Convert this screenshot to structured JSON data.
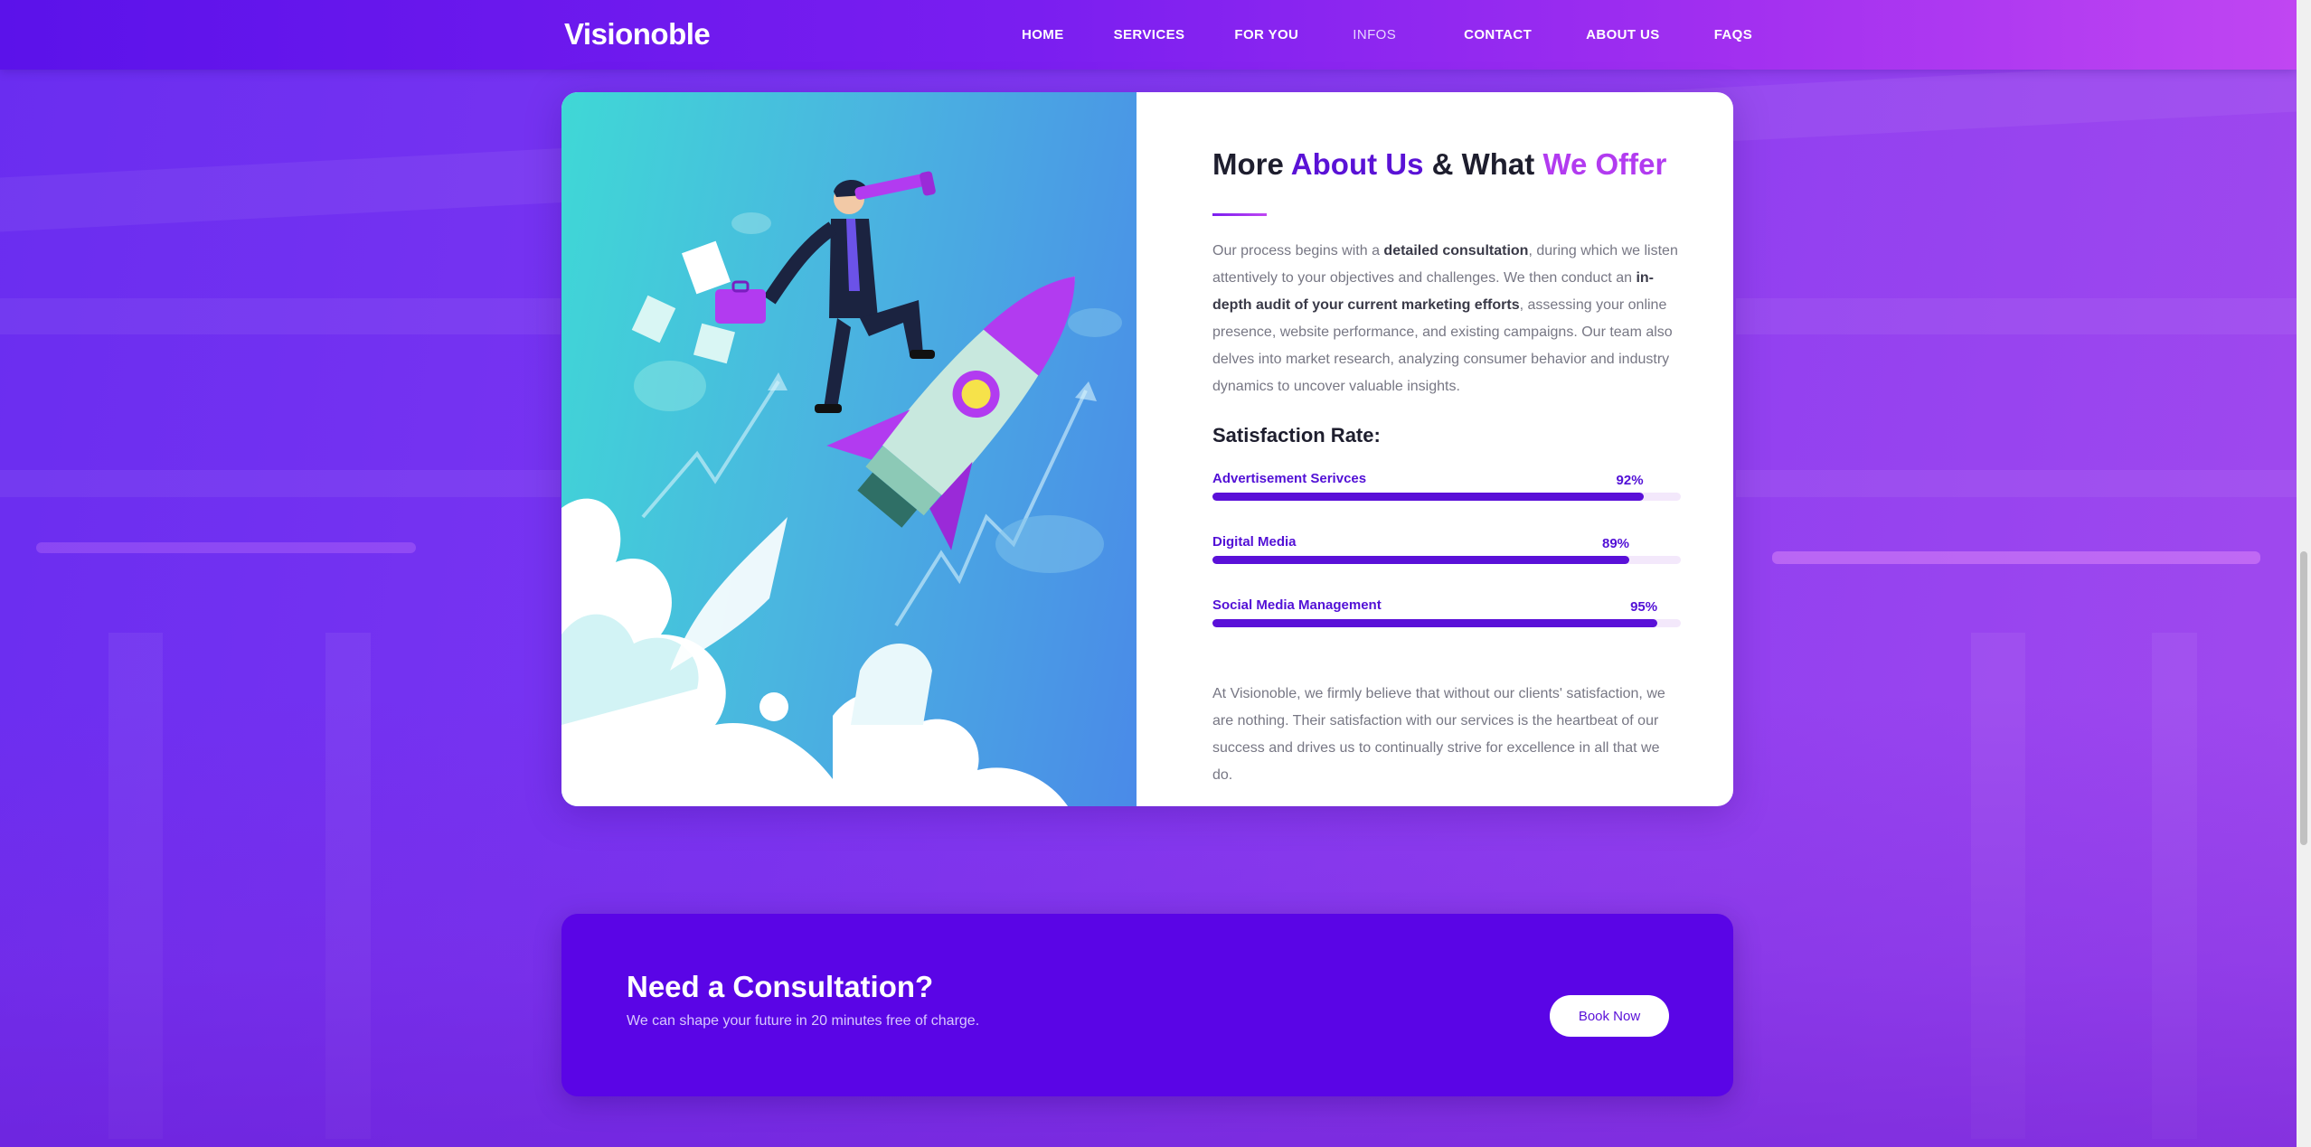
{
  "brand": {
    "logo_text": "Visionoble"
  },
  "nav": {
    "items": [
      {
        "label": "HOME"
      },
      {
        "label": "SERVICES"
      },
      {
        "label": "FOR YOU"
      },
      {
        "label": "INFOS"
      },
      {
        "label": "CONTACT"
      },
      {
        "label": "ABOUT US"
      },
      {
        "label": "FAQS"
      }
    ]
  },
  "about": {
    "heading": {
      "part1": "More ",
      "highlight1": "About Us",
      "part2": " & What ",
      "highlight2": "We Offer"
    },
    "intro": {
      "t1": "Our process begins with a ",
      "b1": "detailed consultation",
      "t2": ", during which we listen attentively to your objectives and challenges. We then conduct an ",
      "b2": "in-depth audit of your current marketing efforts",
      "t3": ", assessing your online presence, website performance, and existing campaigns. Our team also delves into market research, analyzing consumer behavior and industry dynamics to uncover valuable insights."
    },
    "satisfaction_title": "Satisfaction Rate:",
    "bars": [
      {
        "label": "Advertisement Serivces",
        "percent_text": "92%",
        "value": 92
      },
      {
        "label": "Digital Media",
        "percent_text": "89%",
        "value": 89
      },
      {
        "label": "Social Media Management",
        "percent_text": "95%",
        "value": 95
      }
    ],
    "closing": "At Visionoble, we firmly believe that without our clients' satisfaction, we are nothing. Their satisfaction with our services is the heartbeat of our success and drives us to continually strive for excellence in all that we do."
  },
  "cta": {
    "title_part1": "Need a ",
    "title_part2": "Consultation?",
    "subtitle": "We can shape your future in 20 minutes free of charge.",
    "button_label": "Book Now"
  },
  "colors": {
    "primary": "#5a05e6",
    "accent": "#b23bf0",
    "bar_fill": "#5a10d8",
    "bar_track": "#f3e8fb"
  }
}
